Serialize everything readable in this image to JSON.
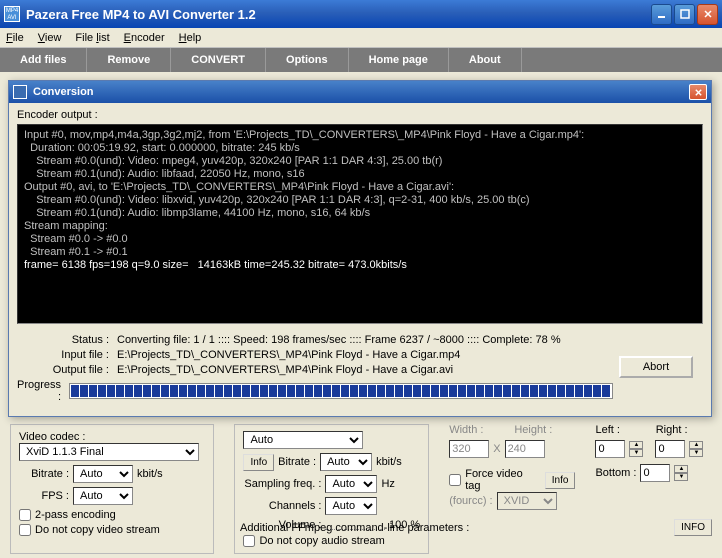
{
  "window": {
    "title": "Pazera Free MP4 to AVI Converter 1.2"
  },
  "menu": {
    "file": "File",
    "view": "View",
    "filelist": "File list",
    "encoder": "Encoder",
    "help": "Help"
  },
  "actions": {
    "add": "Add files",
    "remove": "Remove",
    "convert": "CONVERT",
    "options": "Options",
    "home": "Home page",
    "about": "About"
  },
  "modal": {
    "title": "Conversion",
    "encoder_label": "Encoder output :",
    "console_lines": [
      "Input #0, mov,mp4,m4a,3gp,3g2,mj2, from 'E:\\Projects_TD\\_CONVERTERS\\_MP4\\Pink Floyd - Have a Cigar.mp4':",
      "  Duration: 00:05:19.92, start: 0.000000, bitrate: 245 kb/s",
      "    Stream #0.0(und): Video: mpeg4, yuv420p, 320x240 [PAR 1:1 DAR 4:3], 25.00 tb(r)",
      "    Stream #0.1(und): Audio: libfaad, 22050 Hz, mono, s16",
      "Output #0, avi, to 'E:\\Projects_TD\\_CONVERTERS\\_MP4\\Pink Floyd - Have a Cigar.avi':",
      "    Stream #0.0(und): Video: libxvid, yuv420p, 320x240 [PAR 1:1 DAR 4:3], q=2-31, 400 kb/s, 25.00 tb(c)",
      "    Stream #0.1(und): Audio: libmp3lame, 44100 Hz, mono, s16, 64 kb/s",
      "Stream mapping:",
      "  Stream #0.0 -> #0.0",
      "  Stream #0.1 -> #0.1",
      "frame= 6138 fps=198 q=9.0 size=   14163kB time=245.32 bitrate= 473.0kbits/s"
    ],
    "status_label": "Status :",
    "status_value": "Converting file: 1 / 1  ::::  Speed: 198 frames/sec  ::::  Frame 6237 / ~8000  ::::  Complete: 78 %",
    "input_label": "Input file :",
    "input_value": "E:\\Projects_TD\\_CONVERTERS\\_MP4\\Pink Floyd - Have a Cigar.mp4",
    "output_label": "Output file :",
    "output_value": "E:\\Projects_TD\\_CONVERTERS\\_MP4\\Pink Floyd - Have a Cigar.avi",
    "progress_label": "Progress :",
    "abort": "Abort",
    "progress_segments": 60
  },
  "bg": {
    "video_codec_label": "Video codec :",
    "video_codec": "XviD 1.1.3 Final",
    "bitrate_label": "Bitrate :",
    "bitrate": "Auto",
    "bitrate_unit": "kbit/s",
    "fps_label": "FPS :",
    "fps": "Auto",
    "twopass": "2-pass encoding",
    "nocopy_video": "Do not copy video stream",
    "auto_top": "Auto",
    "info_btn": "Info",
    "abitrate_label": "Bitrate :",
    "abitrate": "Auto",
    "abitrate_unit": "kbit/s",
    "sampling_label": "Sampling freq. :",
    "sampling": "Auto",
    "sampling_unit": "Hz",
    "channels_label": "Channels :",
    "channels": "Auto",
    "volume_label": "Volume :",
    "volume_pct": "100 %",
    "nocopy_audio": "Do not copy audio stream",
    "width_label": "Width :",
    "width": "320",
    "x": "X",
    "height_label": "Height :",
    "height": "240",
    "force_tag": "Force video tag",
    "fourcc_label": "(fourcc) :",
    "fourcc": "XVID",
    "left_label": "Left :",
    "left": "0",
    "right_label": "Right :",
    "right": "0",
    "bottom_label": "Bottom :",
    "bottom": "0",
    "ffmpeg_label": "Additional FFmpeg command-line parameters :",
    "info_caps": "INFO"
  }
}
